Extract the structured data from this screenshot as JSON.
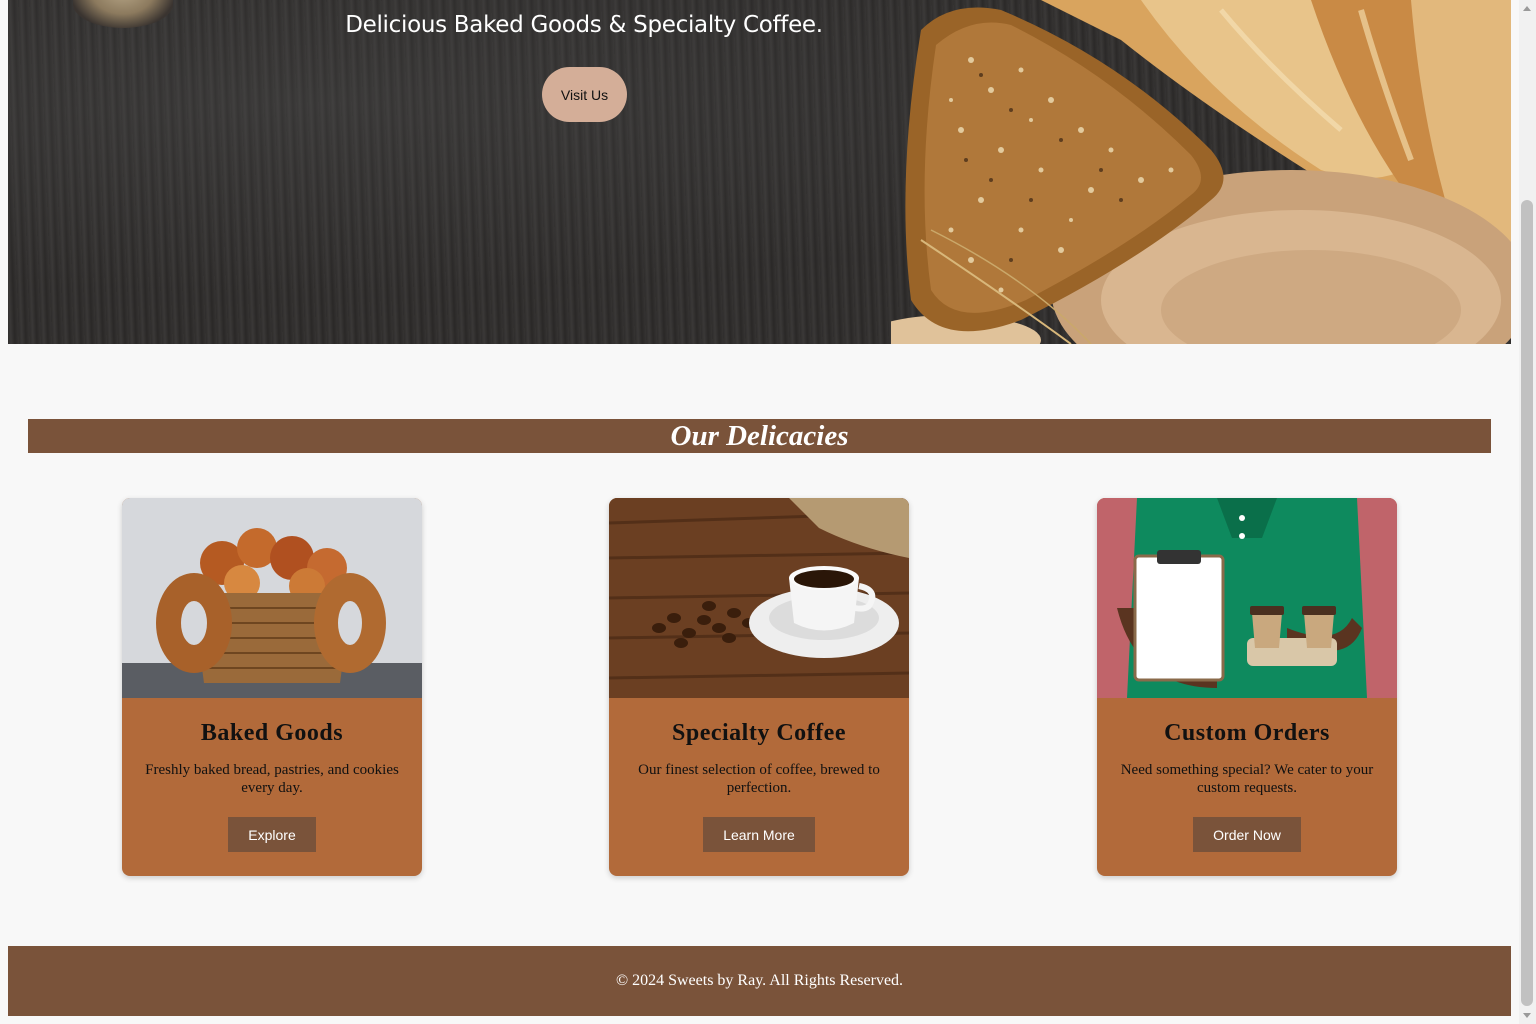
{
  "hero": {
    "title": "Delicious Baked Goods & Specialty Coffee.",
    "button_label": "Visit Us",
    "button_color": "#d4ae98"
  },
  "section": {
    "title": "Our Delicacies"
  },
  "cards": [
    {
      "title": "Baked Goods",
      "description": "Freshly baked bread, pastries, and cookies every day.",
      "button_label": "Explore",
      "image": "basket-of-bread-and-bagels"
    },
    {
      "title": "Specialty Coffee",
      "description": "Our finest selection of coffee, brewed to perfection.",
      "button_label": "Learn More",
      "image": "coffee-cup-with-beans"
    },
    {
      "title": "Custom Orders",
      "description": "Need something special? We cater to your custom requests.",
      "button_label": "Order Now",
      "image": "person-holding-clipboard-and-coffee"
    }
  ],
  "footer": {
    "text": "© 2024 Sweets by Ray. All Rights Reserved."
  },
  "colors": {
    "brand_brown": "#7a533a",
    "card_brown": "#b26a3a",
    "page_background": "#f8f8f8"
  }
}
